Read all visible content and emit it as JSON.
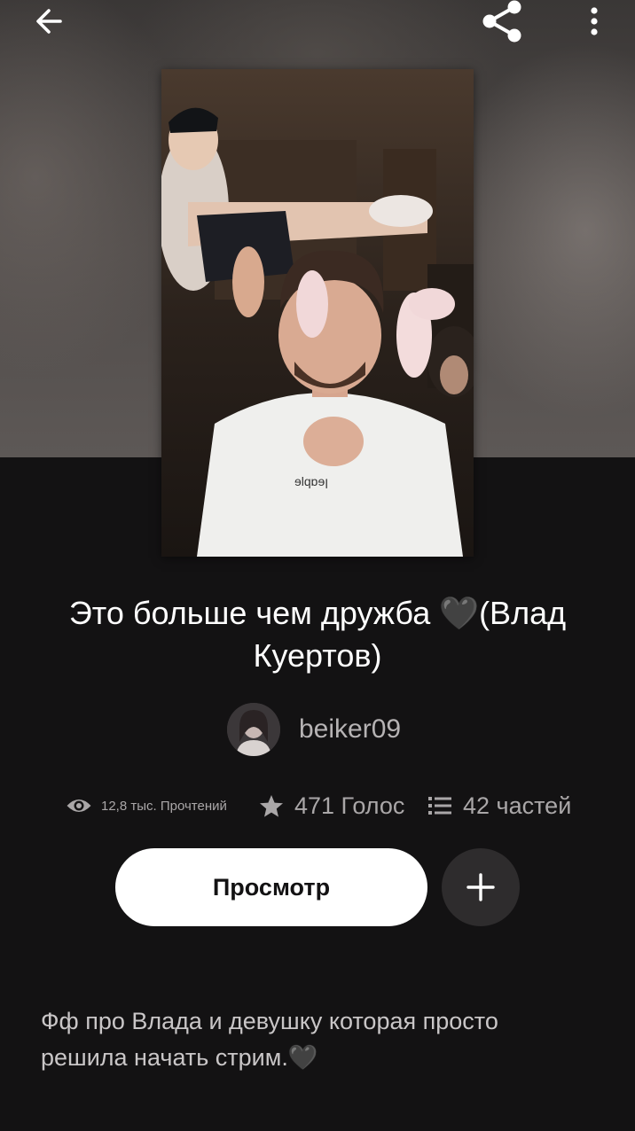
{
  "story": {
    "title_main": "Это больше чем дружба ",
    "title_heart": "🖤",
    "title_tail": "(Влад Куертов)",
    "author": "beiker09",
    "stats": {
      "reads": "12,8 тыс. Прочтений",
      "votes": "471 Голос",
      "parts": "42 частей"
    },
    "read_button_label": "Просмотр",
    "description_text": "Фф про Влада и девушку которая просто решила начать стрим.",
    "description_heart": "🖤"
  },
  "icons": {
    "back": "arrow-left-icon",
    "share": "share-icon",
    "more": "more-vertical-icon",
    "reads": "eye-icon",
    "votes": "star-icon",
    "parts": "list-icon",
    "add": "plus-icon"
  },
  "colors": {
    "background": "#131213",
    "button_bg": "#ffffff",
    "add_button_bg": "#2e2c2d",
    "secondary_text": "#aaa7a8"
  }
}
